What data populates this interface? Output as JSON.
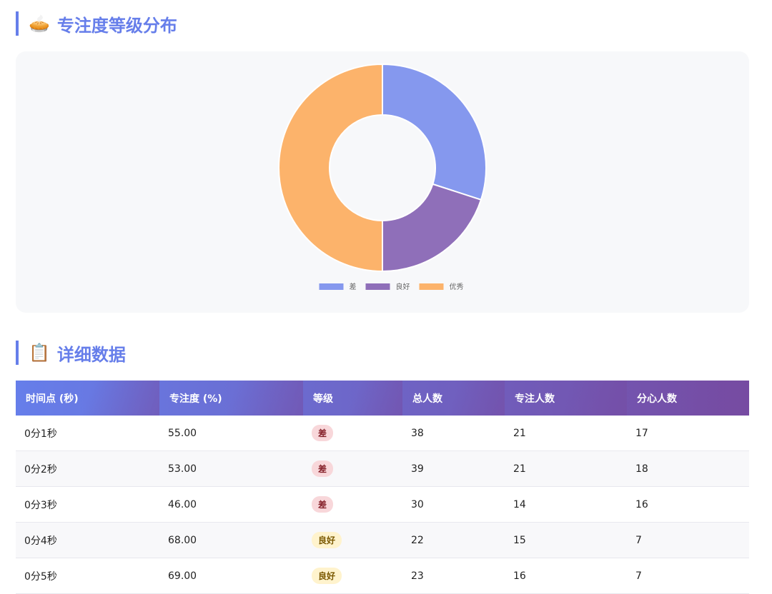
{
  "sections": {
    "distribution": {
      "emoji": "🥧",
      "title": "专注度等级分布"
    },
    "detail": {
      "emoji": "📋",
      "title": "详细数据"
    }
  },
  "chart_data": {
    "type": "pie",
    "donut": true,
    "categories": [
      "差",
      "良好",
      "优秀"
    ],
    "values": [
      3,
      2,
      5
    ],
    "colors": [
      "#8598ee",
      "#8f6fb9",
      "#fcb36b"
    ],
    "legend": "bottom-center",
    "title": ""
  },
  "table": {
    "headers": [
      "时间点 (秒)",
      "专注度 (%)",
      "等级",
      "总人数",
      "专注人数",
      "分心人数"
    ],
    "rows": [
      {
        "time": "0分1秒",
        "focus": "55.00",
        "level": "差",
        "level_class": "bad",
        "total": "38",
        "focused": "21",
        "distracted": "17"
      },
      {
        "time": "0分2秒",
        "focus": "53.00",
        "level": "差",
        "level_class": "bad",
        "total": "39",
        "focused": "21",
        "distracted": "18"
      },
      {
        "time": "0分3秒",
        "focus": "46.00",
        "level": "差",
        "level_class": "bad",
        "total": "30",
        "focused": "14",
        "distracted": "16"
      },
      {
        "time": "0分4秒",
        "focus": "68.00",
        "level": "良好",
        "level_class": "good",
        "total": "22",
        "focused": "15",
        "distracted": "7"
      },
      {
        "time": "0分5秒",
        "focus": "69.00",
        "level": "良好",
        "level_class": "good",
        "total": "23",
        "focused": "16",
        "distracted": "7"
      }
    ]
  }
}
